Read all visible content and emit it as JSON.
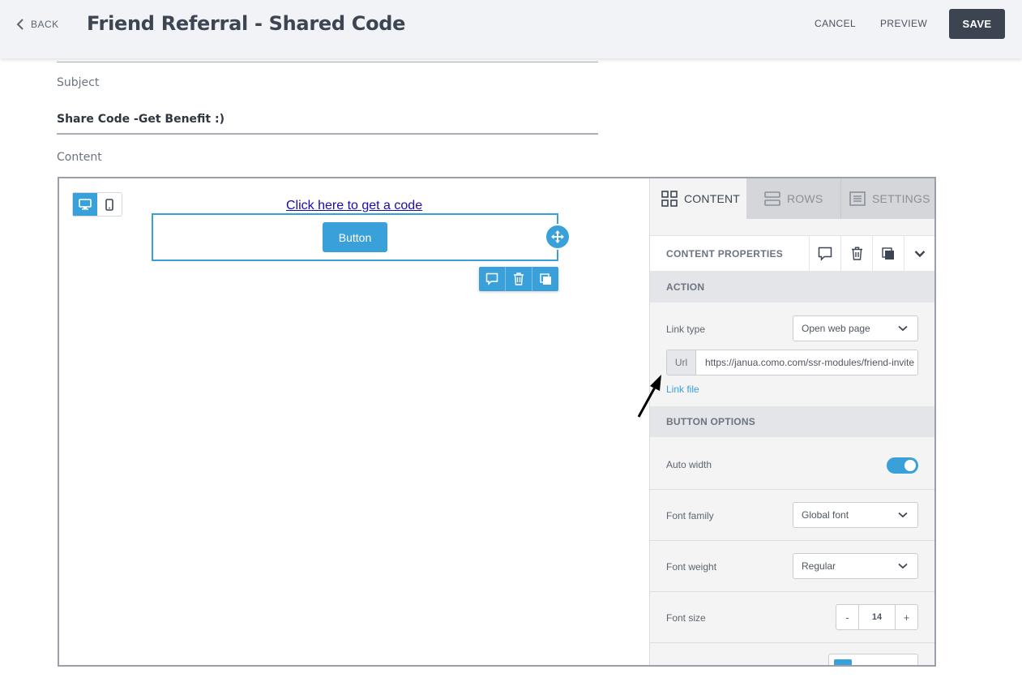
{
  "header": {
    "back_label": "BACK",
    "title": "Friend Referral - Shared Code",
    "cancel_label": "CANCEL",
    "preview_label": "PREVIEW",
    "save_label": "SAVE"
  },
  "form": {
    "subject_label": "Subject",
    "subject_value": "Share Code -Get Benefit :)",
    "content_label": "Content"
  },
  "canvas": {
    "link_text": "Click here to get a code",
    "button_text": "Button"
  },
  "panel": {
    "tabs": [
      {
        "label": "CONTENT",
        "icon": "grid-icon",
        "active": true
      },
      {
        "label": "ROWS",
        "icon": "rows-icon",
        "active": false
      },
      {
        "label": "SETTINGS",
        "icon": "settings-list-icon",
        "active": false
      }
    ],
    "content_properties_title": "CONTENT PROPERTIES",
    "action_section": "ACTION",
    "link_type_label": "Link type",
    "link_type_value": "Open web page",
    "url_addon": "Url",
    "url_value": "https://janua.como.com/ssr-modules/friend-invite",
    "link_file_label": "Link file",
    "button_options_section": "BUTTON OPTIONS",
    "auto_width_label": "Auto width",
    "auto_width_on": true,
    "font_family_label": "Font family",
    "font_family_value": "Global font",
    "font_weight_label": "Font weight",
    "font_weight_value": "Regular",
    "font_size_label": "Font size",
    "font_size_value": "14",
    "stepper_minus": "-",
    "stepper_plus": "+"
  },
  "colors": {
    "accent": "#3aa0d9",
    "save_button": "#3c4452",
    "topbar_bg": "#f1f3f6"
  }
}
